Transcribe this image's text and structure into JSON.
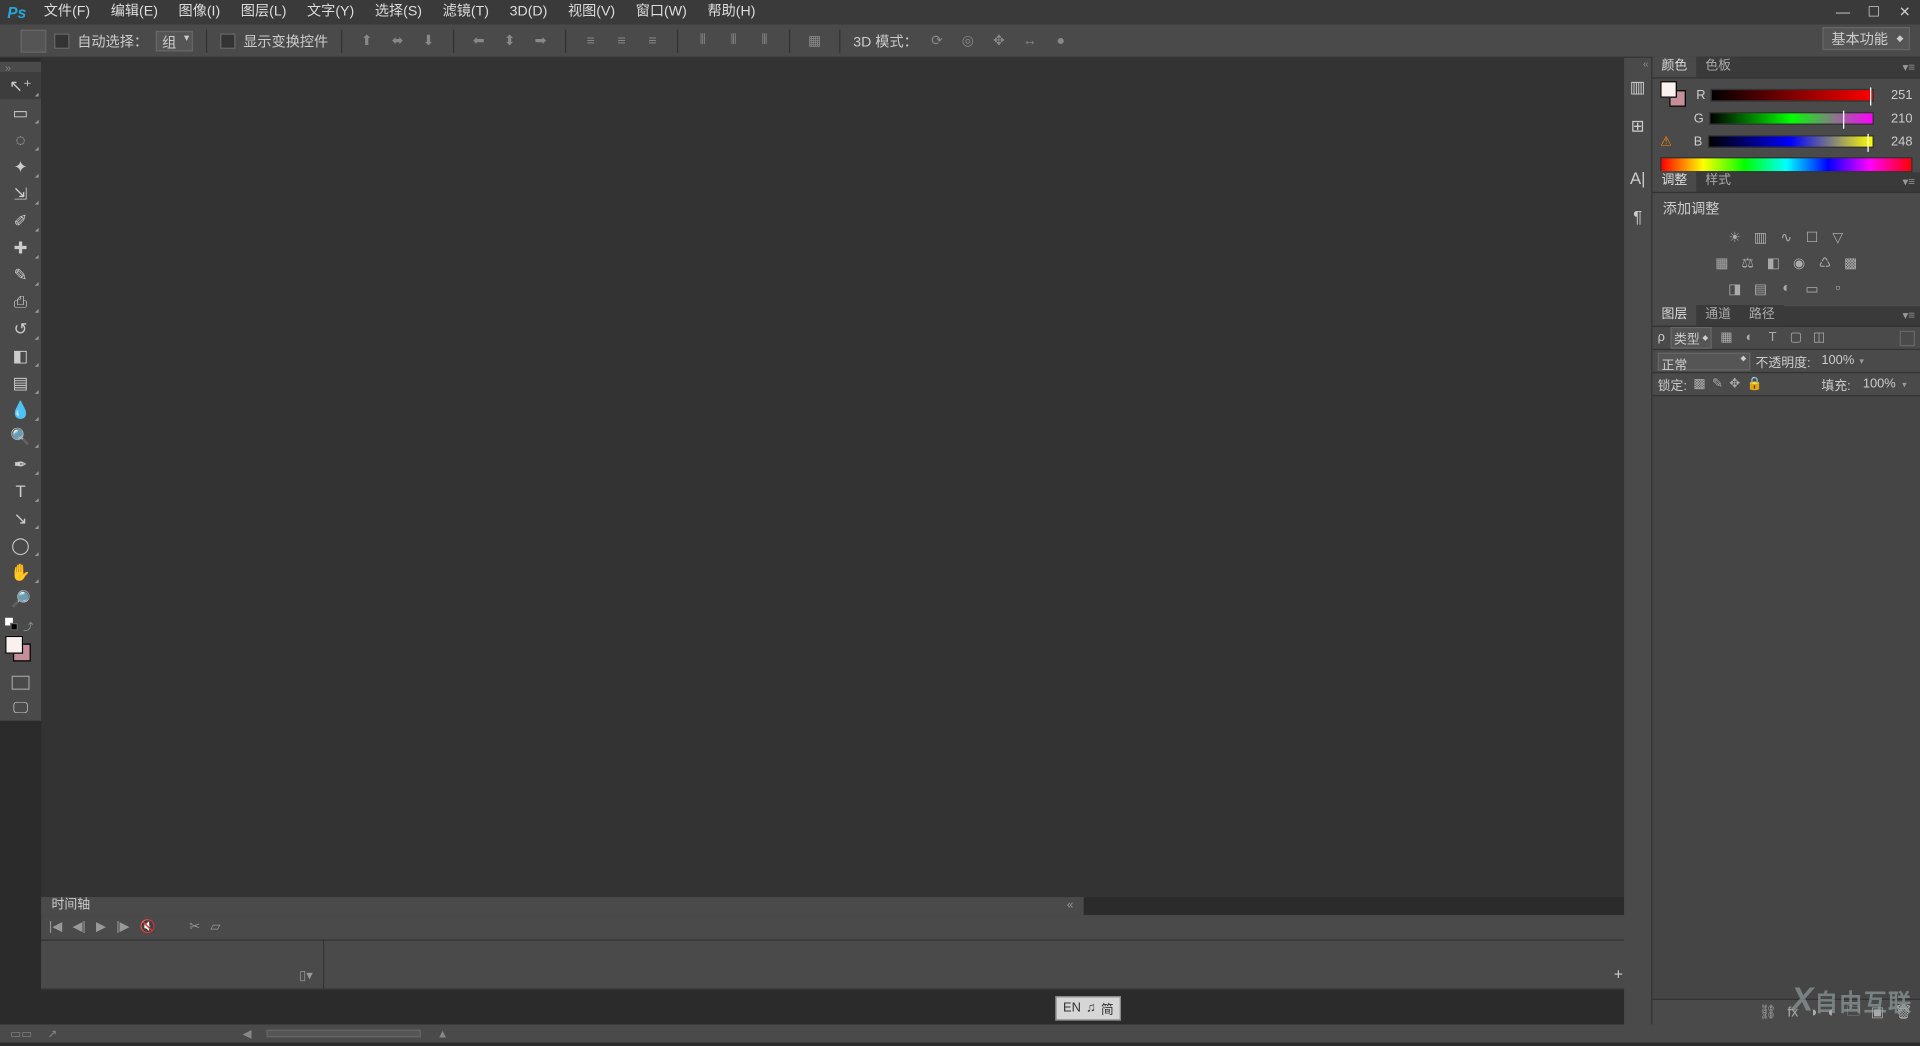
{
  "menubar": {
    "items": [
      "文件(F)",
      "编辑(E)",
      "图像(I)",
      "图层(L)",
      "文字(Y)",
      "选择(S)",
      "滤镜(T)",
      "3D(D)",
      "视图(V)",
      "窗口(W)",
      "帮助(H)"
    ],
    "logo": "Ps"
  },
  "options": {
    "auto_select_label": "自动选择：",
    "auto_select_value": "组",
    "show_transform_label": "显示变换控件",
    "mode3d_label": "3D 模式："
  },
  "workspace": {
    "current": "基本功能"
  },
  "tools": {
    "list": [
      {
        "name": "move-tool",
        "glyph": "↖⁺",
        "sel": true
      },
      {
        "name": "rectangular-marquee-tool",
        "glyph": "▭"
      },
      {
        "name": "lasso-tool",
        "glyph": "◌"
      },
      {
        "name": "magic-wand-tool",
        "glyph": "✦"
      },
      {
        "name": "crop-tool",
        "glyph": "⇲"
      },
      {
        "name": "eyedropper-tool",
        "glyph": "✐"
      },
      {
        "name": "healing-brush-tool",
        "glyph": "✚"
      },
      {
        "name": "brush-tool",
        "glyph": "✎"
      },
      {
        "name": "clone-stamp-tool",
        "glyph": "⎙"
      },
      {
        "name": "history-brush-tool",
        "glyph": "↺"
      },
      {
        "name": "eraser-tool",
        "glyph": "◧"
      },
      {
        "name": "gradient-tool",
        "glyph": "▤"
      },
      {
        "name": "blur-tool",
        "glyph": "💧"
      },
      {
        "name": "dodge-tool",
        "glyph": "🔍"
      },
      {
        "name": "pen-tool",
        "glyph": "✒"
      },
      {
        "name": "type-tool",
        "glyph": "T"
      },
      {
        "name": "path-selection-tool",
        "glyph": "↘"
      },
      {
        "name": "rectangle-shape-tool",
        "glyph": "◯"
      },
      {
        "name": "hand-tool",
        "glyph": "✋"
      },
      {
        "name": "zoom-tool",
        "glyph": "🔎"
      }
    ]
  },
  "timeline": {
    "tab": "时间轴",
    "mode_btn": "▯▾"
  },
  "ime": {
    "lang": "EN",
    "icon": "♫",
    "mode": "简"
  },
  "color_panel": {
    "tabs": [
      "颜色",
      "色板"
    ],
    "channels": [
      {
        "name": "R",
        "value": "251"
      },
      {
        "name": "G",
        "value": "210"
      },
      {
        "name": "B",
        "value": "248"
      }
    ]
  },
  "adjust_panel": {
    "tabs": [
      "调整",
      "样式"
    ],
    "title": "添加调整"
  },
  "layers_panel": {
    "tabs": [
      "图层",
      "通道",
      "路径"
    ],
    "filter_kind": "类型",
    "blend_mode": "正常",
    "opacity_label": "不透明度:",
    "opacity_value": "100%",
    "lock_label": "锁定:",
    "fill_label": "填充:",
    "fill_value": "100%"
  },
  "collapsed_icons": [
    {
      "name": "histogram-icon",
      "glyph": "▥"
    },
    {
      "name": "navigator-icon",
      "glyph": "⊞"
    },
    {
      "name": "character-icon",
      "glyph": "A|"
    },
    {
      "name": "paragraph-icon",
      "glyph": "¶"
    }
  ],
  "watermark": "自由互联"
}
